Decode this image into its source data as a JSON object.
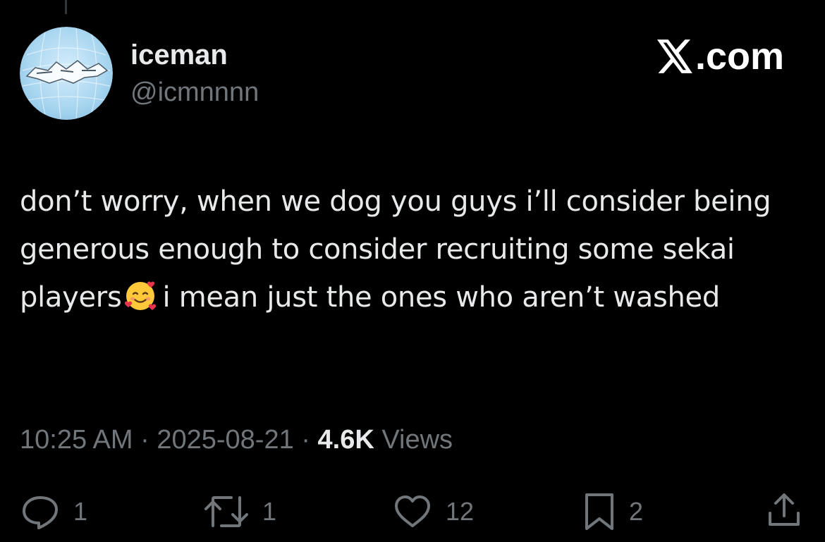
{
  "user": {
    "display_name": "iceman",
    "handle": "@icmnnnn",
    "avatar_label": "iceman"
  },
  "brand": {
    "label": ".com",
    "icon": "x-logo-icon"
  },
  "tweet": {
    "text_before_emoji": "don’t worry, when we dog you guys i’ll consider being generous enough to consider recruiting some sekai players",
    "emoji": "smiling-face-with-hearts",
    "text_after_emoji": "i mean just the ones who aren’t washed"
  },
  "meta": {
    "time": "10:25 AM",
    "separator": "·",
    "date": "2025-08-21",
    "views_count": "4.6K",
    "views_label": "Views"
  },
  "actions": {
    "reply_count": "1",
    "repost_count": "1",
    "like_count": "12",
    "bookmark_count": "2"
  },
  "colors": {
    "background": "#000000",
    "primary_text": "#e7e9ea",
    "secondary_text": "#71767b"
  }
}
